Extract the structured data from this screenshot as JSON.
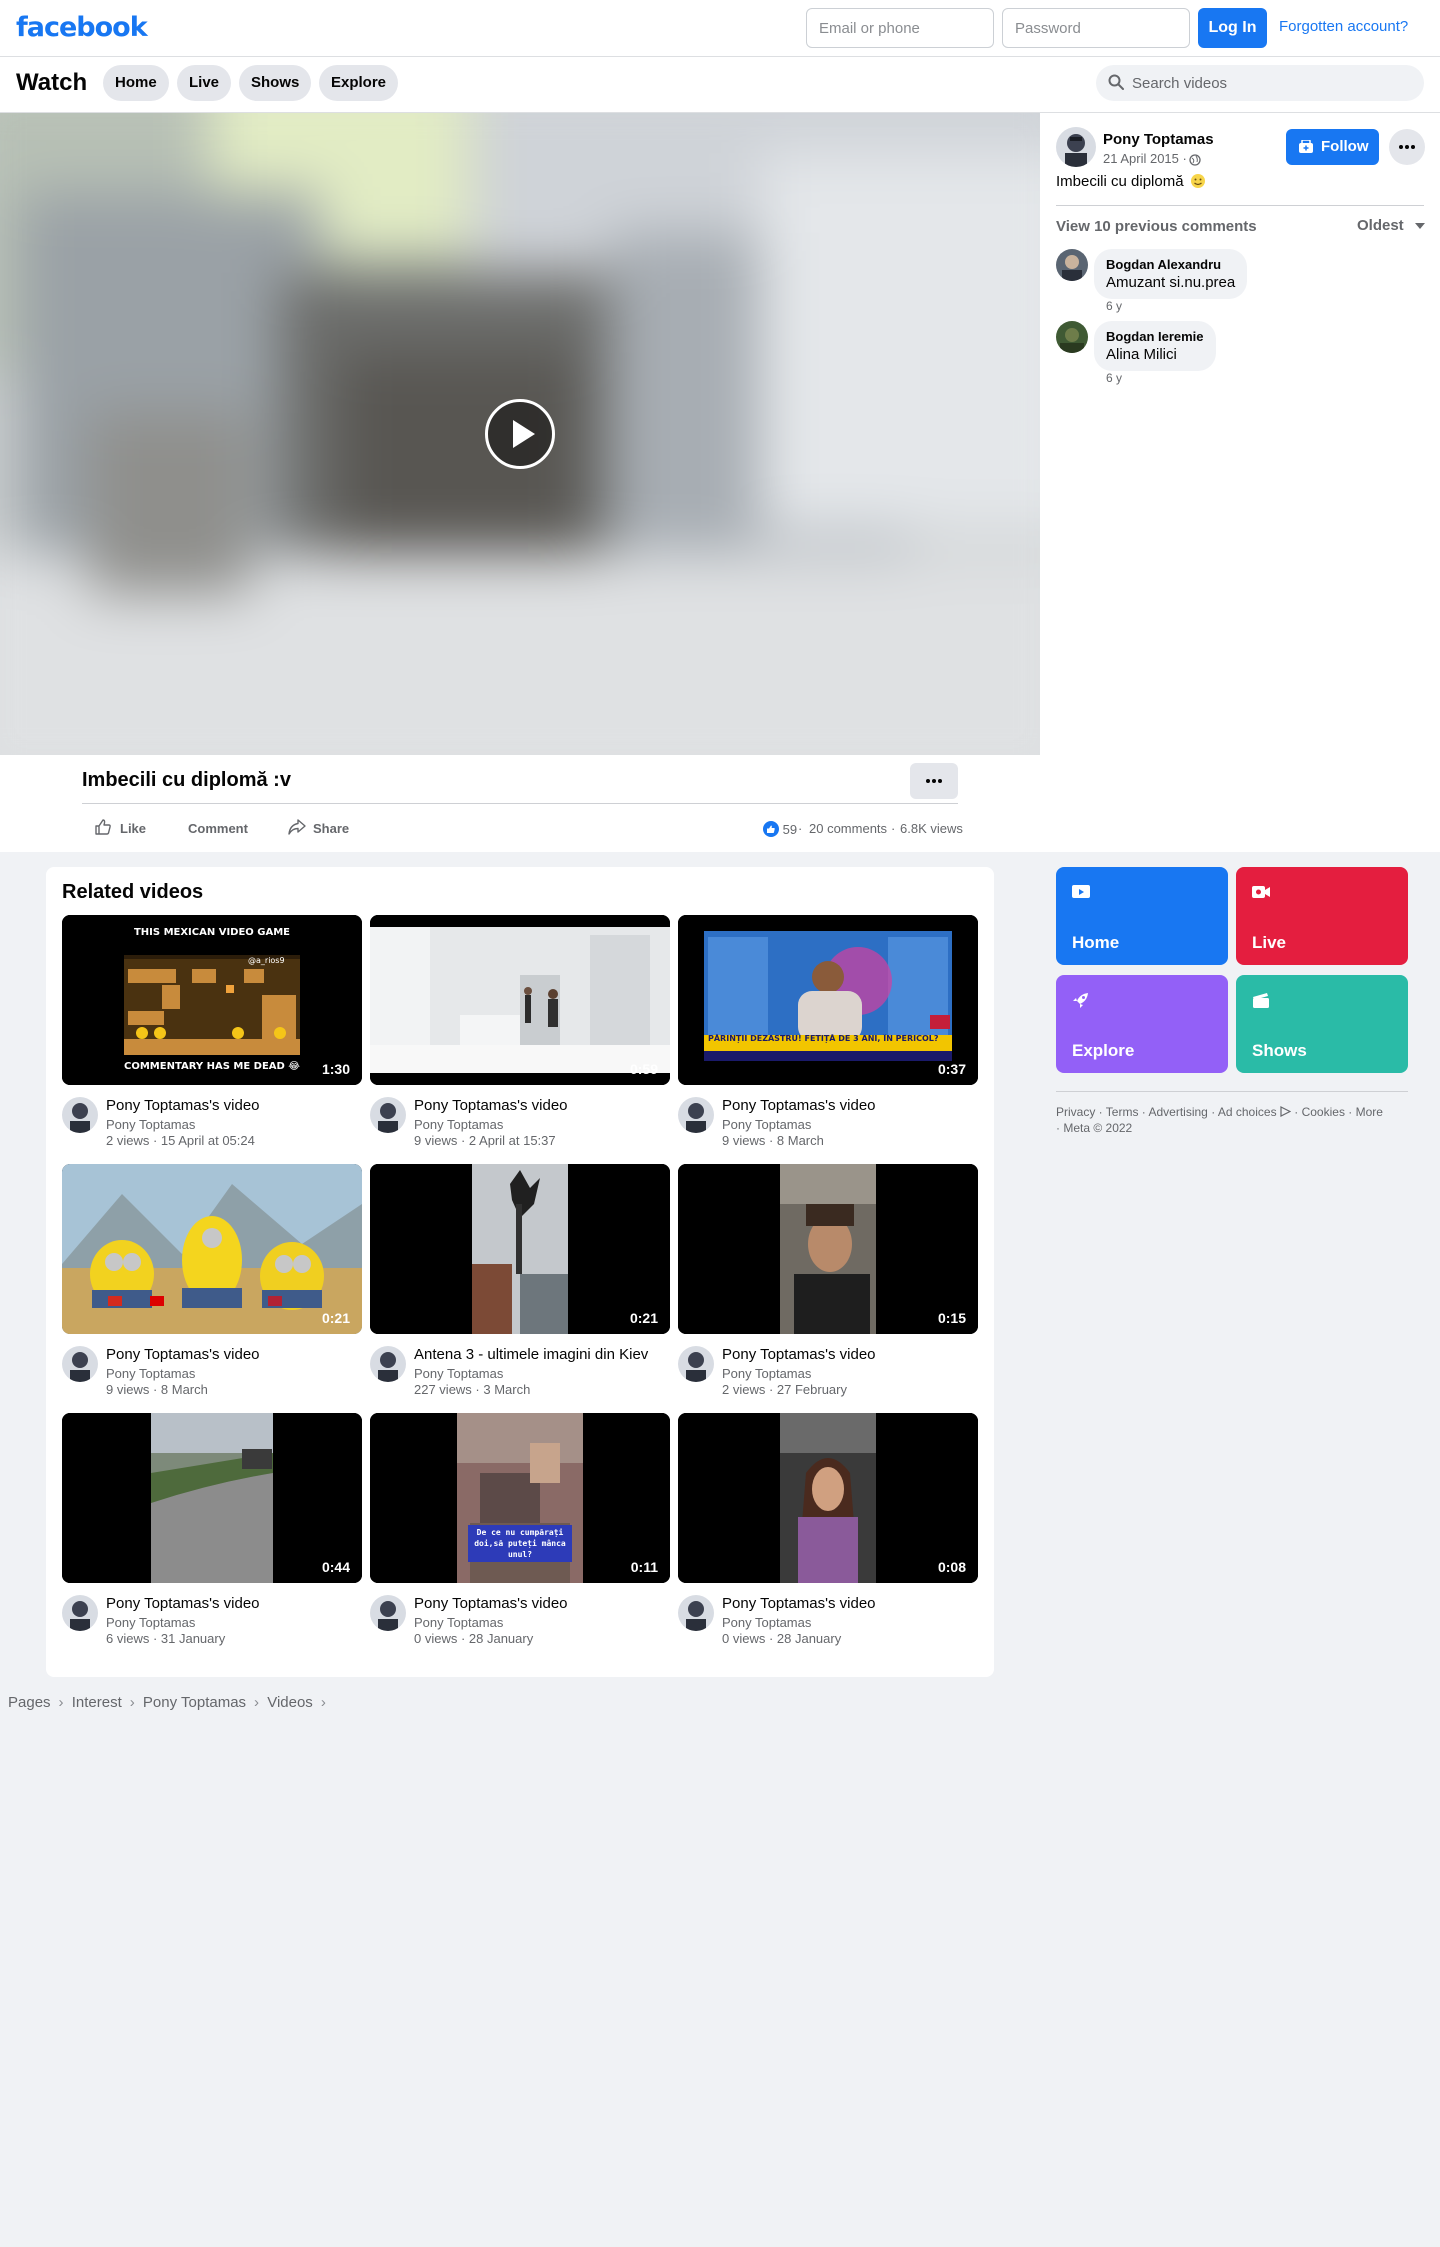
{
  "topbar": {
    "logo": "facebook",
    "email_placeholder": "Email or phone",
    "password_placeholder": "Password",
    "login_label": "Log In",
    "forgot_label": "Forgotten account?"
  },
  "watch_header": {
    "title": "Watch",
    "tabs": [
      {
        "label": "Home"
      },
      {
        "label": "Live"
      },
      {
        "label": "Shows"
      },
      {
        "label": "Explore"
      }
    ],
    "search_placeholder": "Search videos"
  },
  "post": {
    "page_name": "Pony Toptamas",
    "date": "21 April 2015 ·",
    "follow_label": "Follow",
    "caption": "Imbecili cu diplomă",
    "view_previous": "View 10 previous comments",
    "order_label": "Oldest",
    "comments": [
      {
        "author": "Bogdan Alexandru",
        "text": "Amuzant si.nu.prea",
        "time": "6 y"
      },
      {
        "author": "Bogdan Ieremie",
        "text": "Alina Milici",
        "time": "6 y"
      }
    ]
  },
  "video": {
    "title": "Imbecili cu diplomă :v",
    "actions": {
      "like": "Like",
      "comment": "Comment",
      "share": "Share"
    },
    "reactions": "59",
    "comments_count": "20 comments",
    "views": "6.8K views",
    "sep": "·"
  },
  "related": {
    "title": "Related videos",
    "videos": [
      {
        "title": "Pony Toptamas's video",
        "author": "Pony Toptamas",
        "meta": "2 views · 15 April at 05:24",
        "duration": "1:30",
        "thumb_title": "THIS MEXICAN VIDEO GAME",
        "thumb_handle": "@a_rios9",
        "thumb_caption": "COMMENTARY HAS ME DEAD 😂"
      },
      {
        "title": "Pony Toptamas's video",
        "author": "Pony Toptamas",
        "meta": "9 views · 2 April at 15:37",
        "duration": "0:59"
      },
      {
        "title": "Pony Toptamas's video",
        "author": "Pony Toptamas",
        "meta": "9 views · 8 March",
        "duration": "0:37",
        "thumb_caption": "PĂRINȚII DEZASTRU! FETIȚĂ DE 3 ANI, ÎN PERICOL?"
      },
      {
        "title": "Pony Toptamas's video",
        "author": "Pony Toptamas",
        "meta": "9 views · 8 March",
        "duration": "0:21"
      },
      {
        "title": "Antena 3 - ultimele imagini din Kiev",
        "author": "Pony Toptamas",
        "meta": "227 views · 3 March",
        "duration": "0:21"
      },
      {
        "title": "Pony Toptamas's video",
        "author": "Pony Toptamas",
        "meta": "2 views · 27 February",
        "duration": "0:15"
      },
      {
        "title": "Pony Toptamas's video",
        "author": "Pony Toptamas",
        "meta": "6 views · 31 January",
        "duration": "0:44"
      },
      {
        "title": "Pony Toptamas's video",
        "author": "Pony Toptamas",
        "meta": "0 views · 28 January",
        "duration": "0:11",
        "thumb_caption": "De ce nu cumpărați doi,să puteți mânca unul?"
      },
      {
        "title": "Pony Toptamas's video",
        "author": "Pony Toptamas",
        "meta": "0 views · 28 January",
        "duration": "0:08"
      }
    ]
  },
  "nav_tiles": [
    {
      "label": "Home",
      "color": "#1877f2",
      "icon": "play-screen-icon"
    },
    {
      "label": "Live",
      "color": "#e41e3f",
      "icon": "live-camera-icon"
    },
    {
      "label": "Explore",
      "color": "#9360f7",
      "icon": "rocket-icon"
    },
    {
      "label": "Shows",
      "color": "#2abba7",
      "icon": "clapperboard-icon"
    }
  ],
  "footer": {
    "links": [
      "Privacy",
      "Terms",
      "Advertising",
      "Ad choices",
      "Cookies",
      "More"
    ],
    "copyright": "Meta © 2022"
  },
  "breadcrumb": [
    "Pages",
    "Interest",
    "Pony Toptamas",
    "Videos"
  ]
}
